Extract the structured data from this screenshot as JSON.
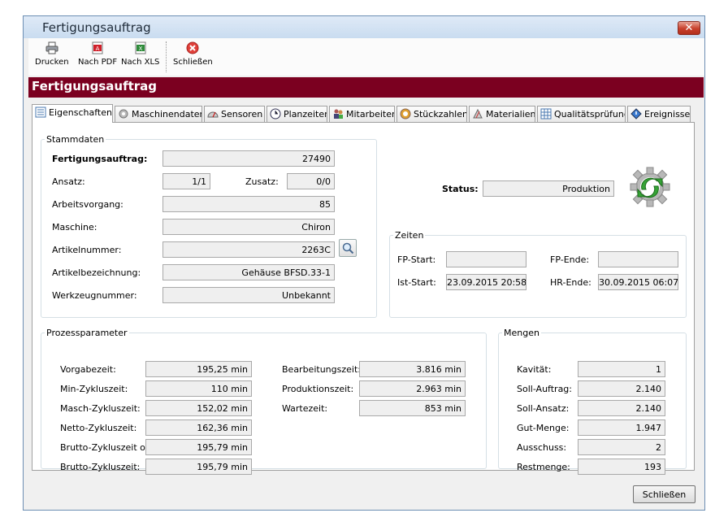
{
  "window": {
    "title": "Fertigungsauftrag",
    "close_symbol": "✕"
  },
  "toolbar": {
    "print": "Drucken",
    "pdf": "Nach PDF",
    "xls": "Nach XLS",
    "close": "Schließen"
  },
  "banner": {
    "title": "Fertigungsauftrag"
  },
  "tabs": [
    {
      "label": "Eigenschaften",
      "icon": "properties-icon"
    },
    {
      "label": "Maschinendaten",
      "icon": "gear-icon"
    },
    {
      "label": "Sensoren",
      "icon": "gauge-icon"
    },
    {
      "label": "Planzeiten",
      "icon": "clock-icon"
    },
    {
      "label": "Mitarbeiter",
      "icon": "users-icon"
    },
    {
      "label": "Stückzahlen",
      "icon": "counter-icon"
    },
    {
      "label": "Materialien",
      "icon": "materials-icon"
    },
    {
      "label": "Qualitätsprüfung",
      "icon": "quality-icon"
    },
    {
      "label": "Ereignisse",
      "icon": "events-icon"
    }
  ],
  "stammdaten": {
    "legend": "Stammdaten",
    "fertigungsauftrag": {
      "label": "Fertigungsauftrag:",
      "value": "27490"
    },
    "ansatz": {
      "label": "Ansatz:",
      "value": "1/1"
    },
    "zusatz": {
      "label": "Zusatz:",
      "value": "0/0"
    },
    "arbeitsvorgang": {
      "label": "Arbeitsvorgang:",
      "value": "85"
    },
    "maschine": {
      "label": "Maschine:",
      "value": "Chiron"
    },
    "artikelnummer": {
      "label": "Artikelnummer:",
      "value": "2263C"
    },
    "artikelbezeichnung": {
      "label": "Artikelbezeichnung:",
      "value": "Gehäuse BFSD.33-1"
    },
    "werkzeugnummer": {
      "label": "Werkzeugnummer:",
      "value": "Unbekannt"
    }
  },
  "status": {
    "label": "Status:",
    "value": "Produktion"
  },
  "zeiten": {
    "legend": "Zeiten",
    "fp_start": {
      "label": "FP-Start:",
      "value": ""
    },
    "fp_ende": {
      "label": "FP-Ende:",
      "value": ""
    },
    "ist_start": {
      "label": "Ist-Start:",
      "value": "23.09.2015 20:58"
    },
    "hr_ende": {
      "label": "HR-Ende:",
      "value": "30.09.2015 06:07"
    }
  },
  "prozess": {
    "legend": "Prozessparameter",
    "left": [
      {
        "label": "Vorgabezeit:",
        "value": "195,25 min"
      },
      {
        "label": "Min-Zykluszeit:",
        "value": "110 min"
      },
      {
        "label": "Masch-Zykluszeit:",
        "value": "152,02 min"
      },
      {
        "label": "Netto-Zykluszeit:",
        "value": "162,36 min"
      },
      {
        "label": "Brutto-Zykluszeit oS:",
        "value": "195,79 min"
      },
      {
        "label": "Brutto-Zykluszeit:",
        "value": "195,79 min"
      }
    ],
    "right": [
      {
        "label": "Bearbeitungszeit:",
        "value": "3.816 min"
      },
      {
        "label": "Produktionszeit:",
        "value": "2.963 min"
      },
      {
        "label": "Wartezeit:",
        "value": "853 min"
      }
    ]
  },
  "mengen": {
    "legend": "Mengen",
    "rows": [
      {
        "label": "Kavität:",
        "value": "1"
      },
      {
        "label": "Soll-Auftrag:",
        "value": "2.140"
      },
      {
        "label": "Soll-Ansatz:",
        "value": "2.140"
      },
      {
        "label": "Gut-Menge:",
        "value": "1.947"
      },
      {
        "label": "Ausschuss:",
        "value": "2"
      },
      {
        "label": "Restmenge:",
        "value": "193"
      }
    ]
  },
  "footer": {
    "close": "Schließen"
  }
}
